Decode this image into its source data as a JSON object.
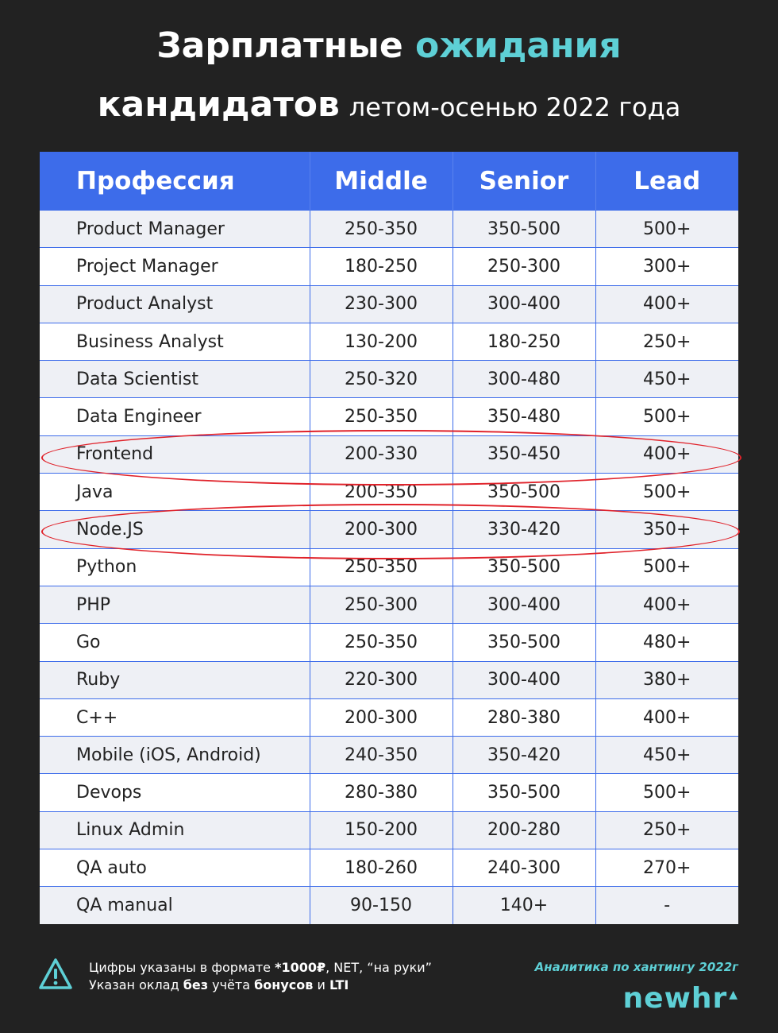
{
  "title": {
    "line1_part1": "Зарплатные",
    "line1_accent": "ожидания",
    "line2_bold": "кандидатов",
    "line2_light": "летом-осенью 2022 года"
  },
  "table": {
    "headers": [
      "Профессия",
      "Middle",
      "Senior",
      "Lead"
    ],
    "rows": [
      [
        "Product Manager",
        "250-350",
        "350-500",
        "500+"
      ],
      [
        "Project Manager",
        "180-250",
        "250-300",
        "300+"
      ],
      [
        "Product Analyst",
        "230-300",
        "300-400",
        "400+"
      ],
      [
        "Business Analyst",
        "130-200",
        "180-250",
        "250+"
      ],
      [
        "Data Scientist",
        "250-320",
        "300-480",
        "450+"
      ],
      [
        "Data Engineer",
        "250-350",
        "350-480",
        "500+"
      ],
      [
        "Frontend",
        "200-330",
        "350-450",
        "400+"
      ],
      [
        "Java",
        "200-350",
        "350-500",
        "500+"
      ],
      [
        "Node.JS",
        "200-300",
        "330-420",
        "350+"
      ],
      [
        "Python",
        "250-350",
        "350-500",
        "500+"
      ],
      [
        "PHP",
        "250-300",
        "300-400",
        "400+"
      ],
      [
        "Go",
        "250-350",
        "350-500",
        "480+"
      ],
      [
        "Ruby",
        "220-300",
        "300-400",
        "380+"
      ],
      [
        "C++",
        "200-300",
        "280-380",
        "400+"
      ],
      [
        "Mobile (iOS, Android)",
        "240-350",
        "350-420",
        "450+"
      ],
      [
        "Devops",
        "280-380",
        "350-500",
        "500+"
      ],
      [
        "Linux Admin",
        "150-200",
        "200-280",
        "250+"
      ],
      [
        "QA auto",
        "180-260",
        "240-300",
        "270+"
      ],
      [
        "QA manual",
        "90-150",
        "140+",
        "-"
      ]
    ],
    "highlighted_rows": [
      "Frontend",
      "Node.JS"
    ]
  },
  "footer": {
    "note_line1_a": "Цифры указаны в формате ",
    "note_line1_b": "*1000₽",
    "note_line1_c": ", NET, “на руки”",
    "note_line2_a": "Указан оклад ",
    "note_line2_b": "без",
    "note_line2_c": " учёта ",
    "note_line2_d": "бонусов",
    "note_line2_e": " и ",
    "note_line2_f": "LTI",
    "warning_icon": "warning-triangle-icon",
    "brand_caption": "Аналитика по хантингу 2022г",
    "brand_logo": "newhr"
  },
  "colors": {
    "background": "#222222",
    "header_blue": "#3d6cea",
    "accent_teal": "#5ed0d6",
    "highlight_red": "#e0222a"
  }
}
